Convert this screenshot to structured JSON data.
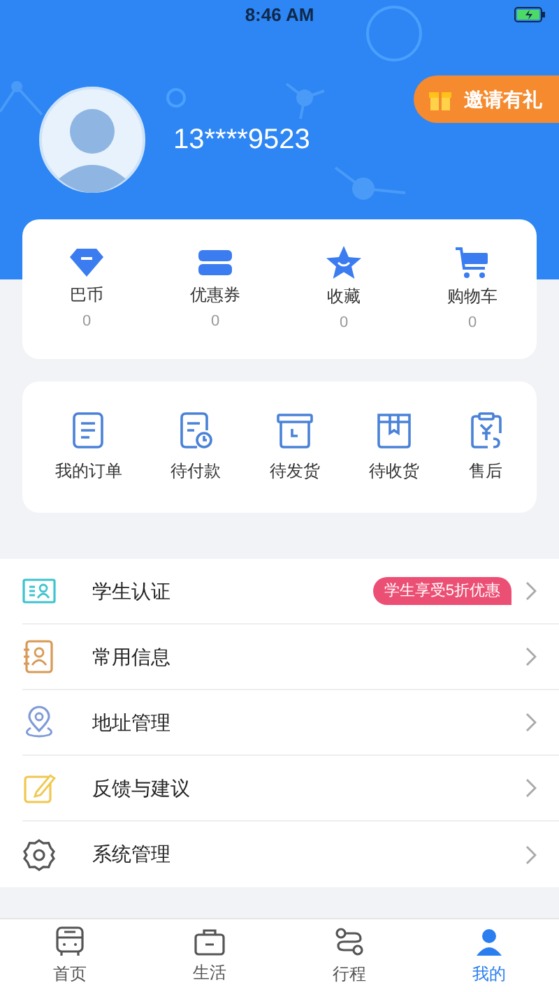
{
  "status_bar": {
    "time": "8:46 AM"
  },
  "profile": {
    "phone": "13****9523",
    "invite_button": "邀请有礼"
  },
  "stats": [
    {
      "label": "巴币",
      "count": "0",
      "kind": "diamond"
    },
    {
      "label": "优惠券",
      "count": "0",
      "kind": "coupon"
    },
    {
      "label": "收藏",
      "count": "0",
      "kind": "star"
    },
    {
      "label": "购物车",
      "count": "0",
      "kind": "cart"
    }
  ],
  "orders": [
    {
      "label": "我的订单",
      "kind": "list"
    },
    {
      "label": "待付款",
      "kind": "pay"
    },
    {
      "label": "待发货",
      "kind": "ship"
    },
    {
      "label": "待收货",
      "kind": "receive"
    },
    {
      "label": "售后",
      "kind": "refund"
    }
  ],
  "menu": [
    {
      "label": "学生认证",
      "kind": "student",
      "badge": "学生享受5折优惠"
    },
    {
      "label": "常用信息",
      "kind": "contact"
    },
    {
      "label": "地址管理",
      "kind": "location"
    },
    {
      "label": "反馈与建议",
      "kind": "feedback"
    },
    {
      "label": "系统管理",
      "kind": "settings"
    }
  ],
  "tab_bar": [
    {
      "label": "首页",
      "kind": "bus",
      "selected": false
    },
    {
      "label": "生活",
      "kind": "bag",
      "selected": false
    },
    {
      "label": "行程",
      "kind": "route",
      "selected": false
    },
    {
      "label": "我的",
      "kind": "person",
      "selected": true
    }
  ]
}
